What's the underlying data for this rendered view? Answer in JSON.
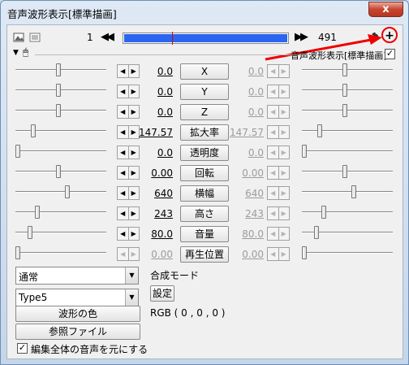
{
  "window": {
    "title": "音声波形表示[標準描画]",
    "close_glyph": "x"
  },
  "toolbar": {
    "frame_start": "1",
    "frame_end": "491",
    "prev_glyph": "◀◀",
    "next_glyph": "▶▶",
    "add_glyph": "+",
    "progress": 1.0
  },
  "object": {
    "label": "音声波形表示[標準描画]",
    "checked": true
  },
  "params": [
    {
      "name": "X",
      "left": "0.0",
      "right": "0.0",
      "left_pos": 0.47,
      "right_pos": 0.47,
      "enabled": true
    },
    {
      "name": "Y",
      "left": "0.0",
      "right": "0.0",
      "left_pos": 0.47,
      "right_pos": 0.47,
      "enabled": true
    },
    {
      "name": "Z",
      "left": "0.0",
      "right": "0.0",
      "left_pos": 0.47,
      "right_pos": 0.47,
      "enabled": true
    },
    {
      "name": "拡大率",
      "left": "147.57",
      "right": "147.57",
      "left_pos": 0.18,
      "right_pos": 0.18,
      "enabled": true
    },
    {
      "name": "透明度",
      "left": "0.0",
      "right": "0.0",
      "left_pos": 0.0,
      "right_pos": 0.0,
      "enabled": true
    },
    {
      "name": "回転",
      "left": "0.00",
      "right": "0.00",
      "left_pos": 0.47,
      "right_pos": 0.47,
      "enabled": true
    },
    {
      "name": "横幅",
      "left": "640",
      "right": "640",
      "left_pos": 0.58,
      "right_pos": 0.58,
      "enabled": true
    },
    {
      "name": "高さ",
      "left": "243",
      "right": "243",
      "left_pos": 0.23,
      "right_pos": 0.23,
      "enabled": true
    },
    {
      "name": "音量",
      "left": "80.0",
      "right": "80.0",
      "left_pos": 0.14,
      "right_pos": 0.14,
      "enabled": true
    },
    {
      "name": "再生位置",
      "left": "0.00",
      "right": "0.00",
      "left_pos": 0.0,
      "right_pos": 0.0,
      "enabled": false
    }
  ],
  "blend": {
    "selected": "通常",
    "label": "合成モード"
  },
  "type": {
    "selected": "Type5",
    "settings_button": "設定"
  },
  "wave_color": {
    "button": "波形の色",
    "value": "RGB ( 0 , 0 , 0 )"
  },
  "reference": {
    "button": "参照ファイル"
  },
  "use_all_audio": {
    "label": "編集全体の音声を元にする",
    "checked": true
  }
}
